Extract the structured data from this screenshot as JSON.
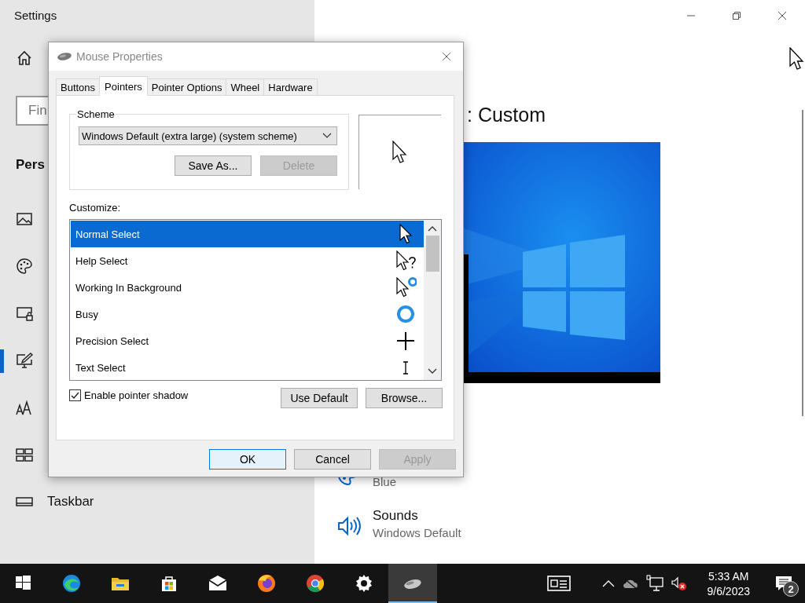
{
  "settings_window": {
    "title": "Settings",
    "search": {
      "placeholder": "Fin"
    },
    "sidebar": {
      "heading": "Pers",
      "items": [
        {
          "selected": false
        },
        {
          "selected": false
        },
        {
          "selected": false
        },
        {
          "selected": true
        },
        {
          "selected": false
        },
        {
          "selected": false
        },
        {
          "label": "Taskbar",
          "selected": false
        }
      ]
    },
    "content": {
      "heading": ": Custom",
      "items": [
        {
          "subtitle": "Blue"
        },
        {
          "title": "Sounds",
          "subtitle": "Windows Default"
        }
      ]
    }
  },
  "dialog": {
    "title": "Mouse Properties",
    "tabs": [
      {
        "label": "Buttons",
        "selected": false
      },
      {
        "label": "Pointers",
        "selected": true
      },
      {
        "label": "Pointer Options",
        "selected": false
      },
      {
        "label": "Wheel",
        "selected": false
      },
      {
        "label": "Hardware",
        "selected": false
      }
    ],
    "scheme": {
      "legend": "Scheme",
      "value": "Windows Default (extra large) (system scheme)",
      "buttons": [
        {
          "label": "Save As...",
          "disabled": false
        },
        {
          "label": "Delete",
          "disabled": true
        }
      ]
    },
    "customize_label": "Customize:",
    "pointers": [
      {
        "label": "Normal Select",
        "selected": true
      },
      {
        "label": "Help Select",
        "selected": false
      },
      {
        "label": "Working In Background",
        "selected": false
      },
      {
        "label": "Busy",
        "selected": false
      },
      {
        "label": "Precision Select",
        "selected": false
      },
      {
        "label": "Text Select",
        "selected": false
      }
    ],
    "shadow_checkbox": {
      "label": "Enable pointer shadow",
      "checked": true
    },
    "list_buttons": [
      {
        "label": "Use Default",
        "disabled": false
      },
      {
        "label": "Browse...",
        "disabled": false
      }
    ],
    "footer_buttons": [
      {
        "label": "OK",
        "disabled": false,
        "default": true
      },
      {
        "label": "Cancel",
        "disabled": false,
        "default": false
      },
      {
        "label": "Apply",
        "disabled": true,
        "default": false
      }
    ]
  },
  "taskbar": {
    "apps": [
      {
        "active": false
      },
      {
        "active": false
      },
      {
        "active": false
      },
      {
        "active": false
      },
      {
        "active": false
      },
      {
        "active": false
      },
      {
        "active": false
      },
      {
        "active": false
      },
      {
        "active": true
      }
    ],
    "clock": {
      "time": "5:33 AM",
      "date": "9/6/2023"
    },
    "notifications": {
      "count": "2"
    }
  }
}
